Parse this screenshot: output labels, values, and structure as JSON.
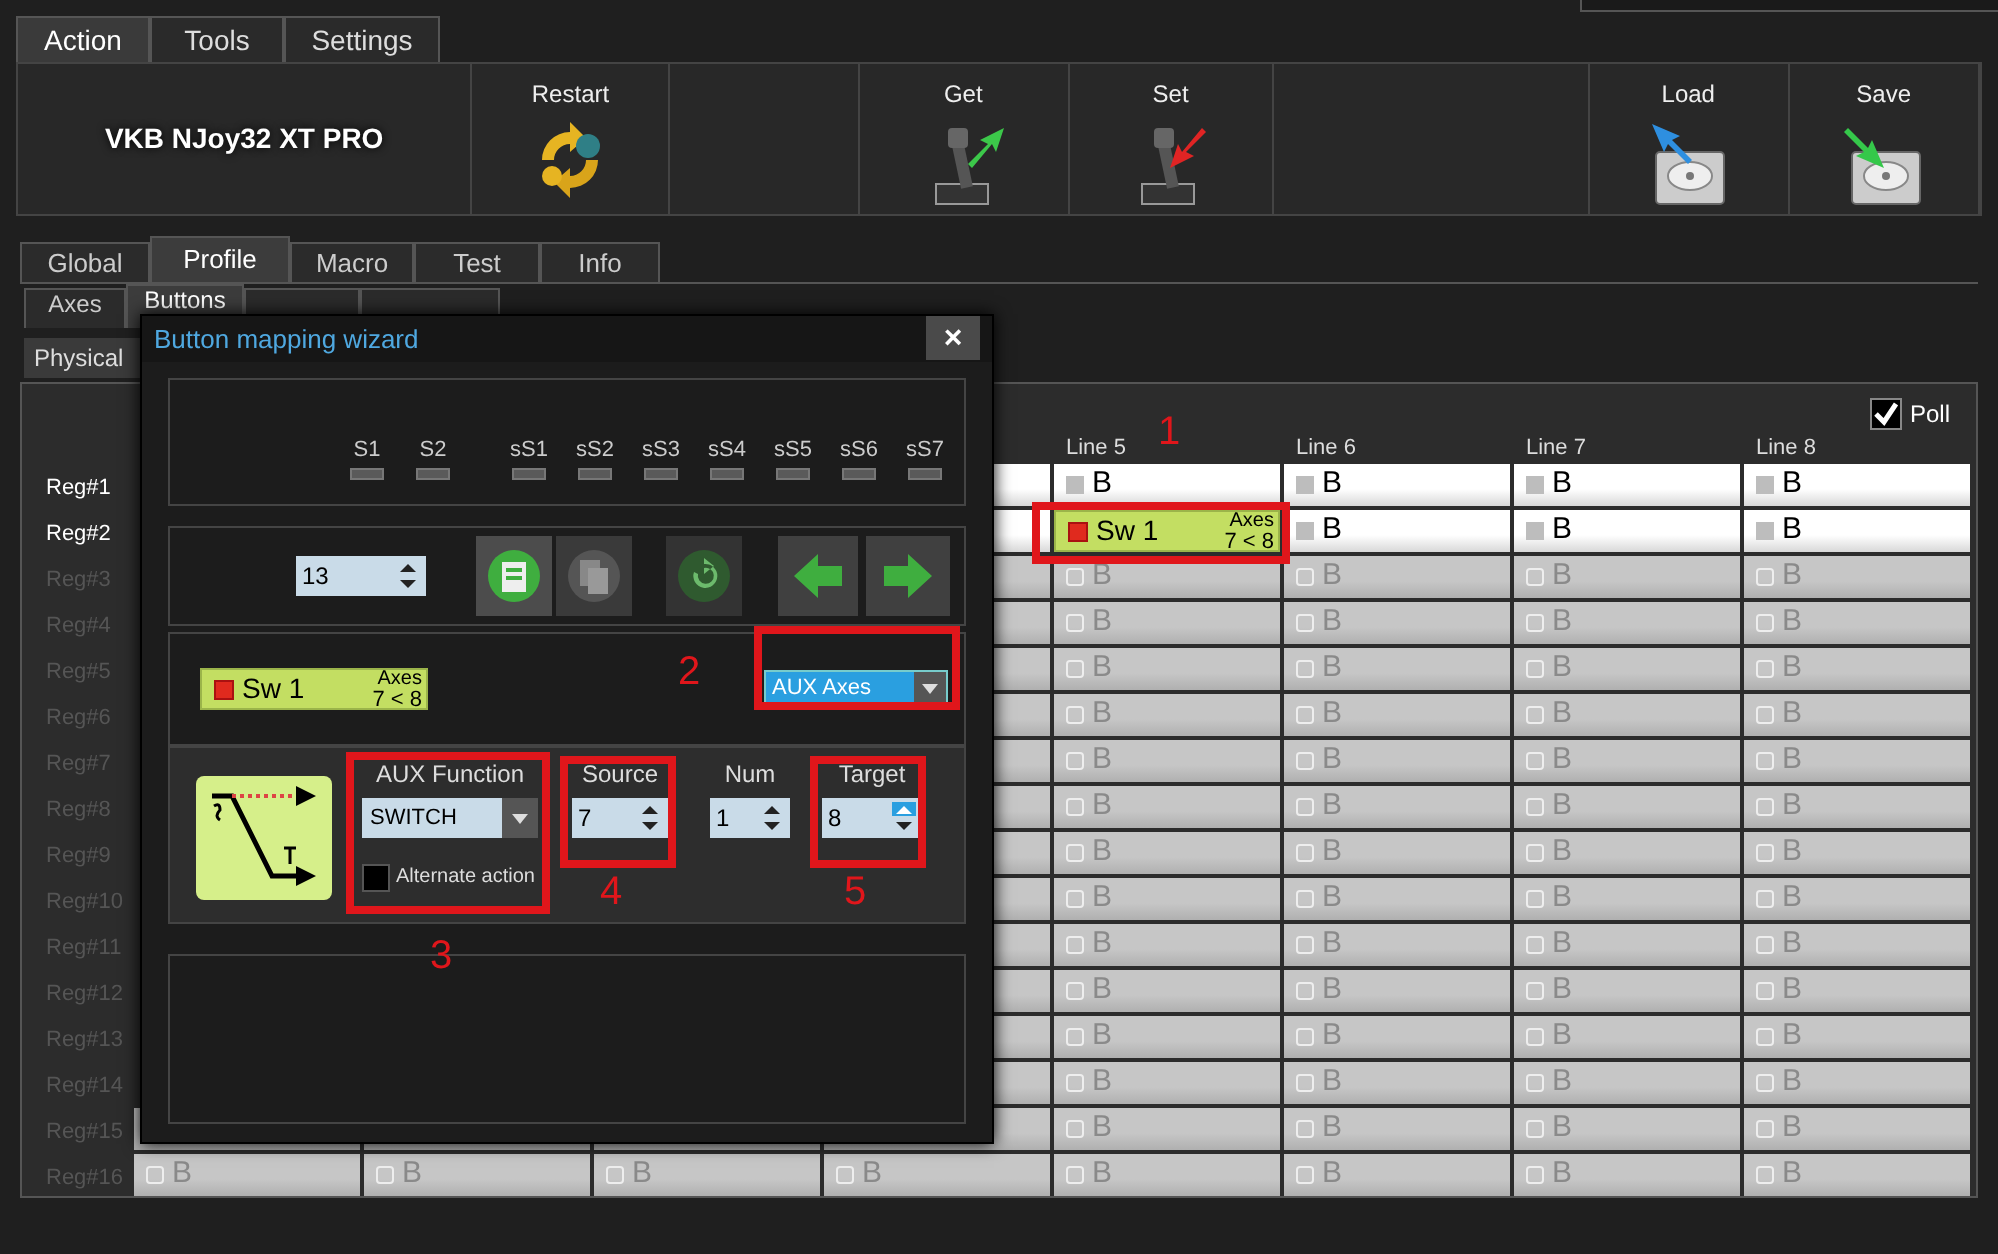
{
  "top_tabs": [
    {
      "label": "Action",
      "selected": true
    },
    {
      "label": "Tools",
      "selected": false
    },
    {
      "label": "Settings",
      "selected": false
    }
  ],
  "device_name": "VKB NJoy32 XT PRO",
  "toolbar": [
    {
      "kind": "restart",
      "label": "Restart"
    },
    {
      "kind": "get",
      "label": "Get"
    },
    {
      "kind": "set",
      "label": "Set"
    },
    {
      "kind": "load",
      "label": "Load"
    },
    {
      "kind": "save",
      "label": "Save"
    }
  ],
  "main_tabs": [
    {
      "label": "Global",
      "selected": false
    },
    {
      "label": "Profile",
      "selected": true
    },
    {
      "label": "Macro",
      "selected": false
    },
    {
      "label": "Test",
      "selected": false
    },
    {
      "label": "Info",
      "selected": false
    }
  ],
  "sub_tabs": [
    {
      "label": "Axes",
      "selected": false
    },
    {
      "label": "Buttons",
      "selected": true
    },
    {
      "selected": false
    },
    {
      "selected": false
    }
  ],
  "view_button": "Physical",
  "poll": {
    "label": "Poll",
    "checked": true
  },
  "grid": {
    "columns": [
      "Line 5",
      "Line 6",
      "Line 7",
      "Line 8"
    ],
    "rows": [
      {
        "label": "Reg#1",
        "enabled": true,
        "cells": [
          {
            "kind": "button",
            "label": "B"
          },
          {
            "kind": "button",
            "label": "B"
          },
          {
            "kind": "button",
            "label": "B"
          },
          {
            "kind": "button",
            "label": "B"
          }
        ]
      },
      {
        "label": "Reg#2",
        "enabled": true,
        "cells": [
          {
            "kind": "switch",
            "label": "Sw 1",
            "tag": "Axes",
            "detail": "7 < 8"
          },
          {
            "kind": "button",
            "label": "B"
          },
          {
            "kind": "button",
            "label": "B"
          },
          {
            "kind": "button",
            "label": "B"
          }
        ]
      },
      {
        "label": "Reg#3",
        "enabled": false,
        "cells": [
          {
            "kind": "button",
            "label": "B"
          },
          {
            "kind": "button",
            "label": "B"
          },
          {
            "kind": "button",
            "label": "B"
          },
          {
            "kind": "button",
            "label": "B"
          }
        ]
      },
      {
        "label": "Reg#4",
        "enabled": false,
        "cells": [
          {
            "kind": "button",
            "label": "B"
          },
          {
            "kind": "button",
            "label": "B"
          },
          {
            "kind": "button",
            "label": "B"
          },
          {
            "kind": "button",
            "label": "B"
          }
        ]
      },
      {
        "label": "Reg#5",
        "enabled": false,
        "cells": [
          {
            "kind": "button",
            "label": "B"
          },
          {
            "kind": "button",
            "label": "B"
          },
          {
            "kind": "button",
            "label": "B"
          },
          {
            "kind": "button",
            "label": "B"
          }
        ]
      },
      {
        "label": "Reg#6",
        "enabled": false,
        "cells": [
          {
            "kind": "button",
            "label": "B"
          },
          {
            "kind": "button",
            "label": "B"
          },
          {
            "kind": "button",
            "label": "B"
          },
          {
            "kind": "button",
            "label": "B"
          }
        ]
      },
      {
        "label": "Reg#7",
        "enabled": false,
        "cells": [
          {
            "kind": "button",
            "label": "B"
          },
          {
            "kind": "button",
            "label": "B"
          },
          {
            "kind": "button",
            "label": "B"
          },
          {
            "kind": "button",
            "label": "B"
          }
        ]
      },
      {
        "label": "Reg#8",
        "enabled": false,
        "cells": [
          {
            "kind": "button",
            "label": "B"
          },
          {
            "kind": "button",
            "label": "B"
          },
          {
            "kind": "button",
            "label": "B"
          },
          {
            "kind": "button",
            "label": "B"
          }
        ]
      },
      {
        "label": "Reg#9",
        "enabled": false,
        "cells": [
          {
            "kind": "button",
            "label": "B"
          },
          {
            "kind": "button",
            "label": "B"
          },
          {
            "kind": "button",
            "label": "B"
          },
          {
            "kind": "button",
            "label": "B"
          }
        ]
      },
      {
        "label": "Reg#10",
        "enabled": false,
        "cells": [
          {
            "kind": "button",
            "label": "B"
          },
          {
            "kind": "button",
            "label": "B"
          },
          {
            "kind": "button",
            "label": "B"
          },
          {
            "kind": "button",
            "label": "B"
          }
        ]
      },
      {
        "label": "Reg#11",
        "enabled": false,
        "cells": [
          {
            "kind": "button",
            "label": "B"
          },
          {
            "kind": "button",
            "label": "B"
          },
          {
            "kind": "button",
            "label": "B"
          },
          {
            "kind": "button",
            "label": "B"
          }
        ]
      },
      {
        "label": "Reg#12",
        "enabled": false,
        "cells": [
          {
            "kind": "button",
            "label": "B"
          },
          {
            "kind": "button",
            "label": "B"
          },
          {
            "kind": "button",
            "label": "B"
          },
          {
            "kind": "button",
            "label": "B"
          }
        ]
      },
      {
        "label": "Reg#13",
        "enabled": false,
        "cells": [
          {
            "kind": "button",
            "label": "B"
          },
          {
            "kind": "button",
            "label": "B"
          },
          {
            "kind": "button",
            "label": "B"
          },
          {
            "kind": "button",
            "label": "B"
          }
        ]
      },
      {
        "label": "Reg#14",
        "enabled": false,
        "cells": [
          {
            "kind": "button",
            "label": "B"
          },
          {
            "kind": "button",
            "label": "B"
          },
          {
            "kind": "button",
            "label": "B"
          },
          {
            "kind": "button",
            "label": "B"
          }
        ]
      },
      {
        "label": "Reg#15",
        "enabled": false,
        "cells": [
          {
            "kind": "button",
            "label": "B"
          },
          {
            "kind": "button",
            "label": "B"
          },
          {
            "kind": "button",
            "label": "B"
          },
          {
            "kind": "button",
            "label": "B"
          }
        ]
      },
      {
        "label": "Reg#16",
        "enabled": false,
        "cells": [
          {
            "kind": "button",
            "label": "B"
          },
          {
            "kind": "button",
            "label": "B"
          },
          {
            "kind": "button",
            "label": "B"
          },
          {
            "kind": "button",
            "label": "B"
          },
          {
            "kind": "button",
            "label": "B"
          },
          {
            "kind": "button",
            "label": "B"
          },
          {
            "kind": "button",
            "label": "B"
          },
          {
            "kind": "button",
            "label": "B"
          }
        ]
      }
    ]
  },
  "dialog": {
    "title": "Button mapping wizard",
    "close": "×",
    "shifts": [
      {
        "label": "S1",
        "on": false
      },
      {
        "label": "S2",
        "on": false
      },
      {
        "label": "sS1",
        "on": false
      },
      {
        "label": "sS2",
        "on": false
      },
      {
        "label": "sS3",
        "on": false
      },
      {
        "label": "sS4",
        "on": false
      },
      {
        "label": "sS5",
        "on": false
      },
      {
        "label": "sS6",
        "on": false
      },
      {
        "label": "sS7",
        "on": false
      }
    ],
    "number": "13",
    "mapping": {
      "kind": "switch",
      "label": "Sw 1",
      "tag": "Axes",
      "detail": "7 < 8"
    },
    "mode": "AUX Axes",
    "aux_function": {
      "label": "AUX Function",
      "value": "SWITCH"
    },
    "alternate": {
      "label": "Alternate action",
      "checked": false
    },
    "spinners": [
      {
        "label": "Source",
        "value": "7",
        "focused": false
      },
      {
        "label": "Num",
        "value": "1",
        "focused": false
      },
      {
        "label": "Target",
        "value": "8",
        "focused": true
      }
    ]
  },
  "annotations": [
    {
      "label": "1"
    },
    {
      "label": "2"
    },
    {
      "label": "3"
    },
    {
      "label": "4"
    },
    {
      "label": "5"
    }
  ]
}
